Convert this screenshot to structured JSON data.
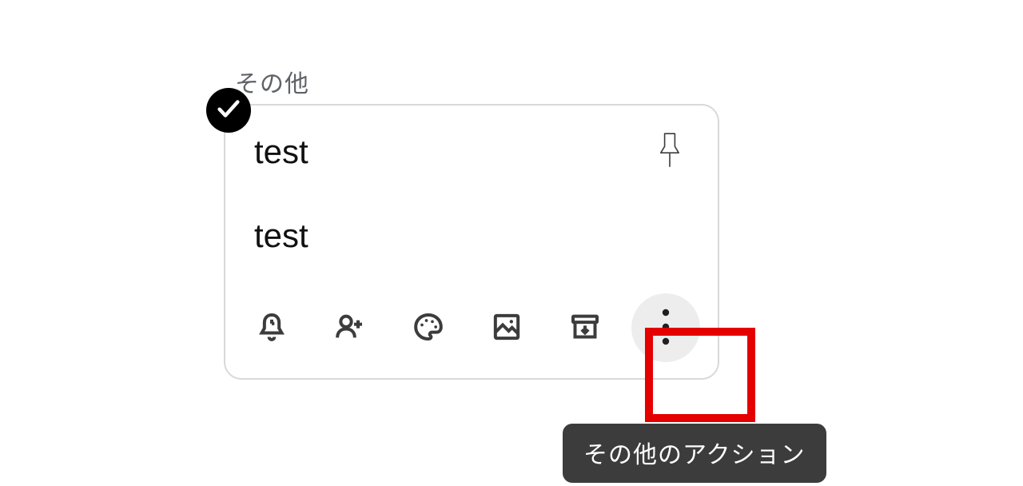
{
  "section": {
    "label": "その他"
  },
  "note": {
    "title": "test",
    "body": "test"
  },
  "icons": {
    "check": "check-icon",
    "pin": "pin-icon",
    "remind": "reminder-bell-icon",
    "collaborator": "person-add-icon",
    "palette": "palette-icon",
    "image": "image-icon",
    "archive": "archive-icon",
    "more": "more-vertical-icon"
  },
  "tooltip": {
    "more_actions": "その他のアクション"
  },
  "colors": {
    "highlight": "#e50000",
    "tooltip_bg": "#3c3c3c",
    "icon": "#3c3c3c"
  }
}
